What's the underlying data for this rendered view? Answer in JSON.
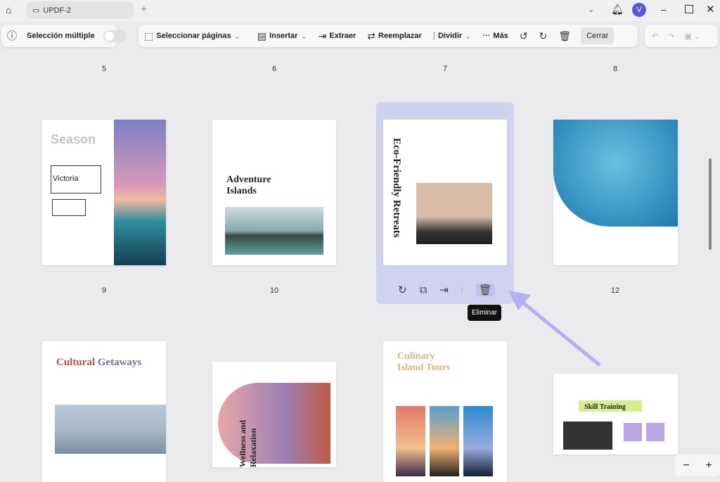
{
  "window": {
    "tab_title": "UPDF-2",
    "avatar_letter": "V"
  },
  "toolbar": {
    "multi_select": "Selección múltiple",
    "select_pages": "Seleccionar páginas",
    "insert": "Insertar",
    "extract": "Extraer",
    "replace": "Reemplazar",
    "split": "Dividir",
    "more": "Más",
    "close": "Cerrar"
  },
  "page_labels_top": [
    "5",
    "6",
    "7",
    "8"
  ],
  "page_labels_mid": [
    "9",
    "10",
    "12"
  ],
  "thumbnails": {
    "p9": {
      "title": "Season",
      "name": "Victoria"
    },
    "p10": {
      "title_line1": "Adventure",
      "title_line2": "Islands"
    },
    "p11": {
      "title": "Eco-Friendly Retreats"
    },
    "p13": {
      "title_a": "Cultural",
      "title_b": "Getaways"
    },
    "p14": {
      "title": "Wellness and Relaxation"
    },
    "p15": {
      "title_line1": "Culinary",
      "title_line2": "Island Tours"
    },
    "p16": {
      "title": "Skill Training"
    }
  },
  "page_actions": {
    "tooltip": "Eliminar"
  },
  "colors": {
    "accent": "#6b64e0",
    "selection": "#d0d2f0",
    "arrow": "#b3aef5"
  }
}
